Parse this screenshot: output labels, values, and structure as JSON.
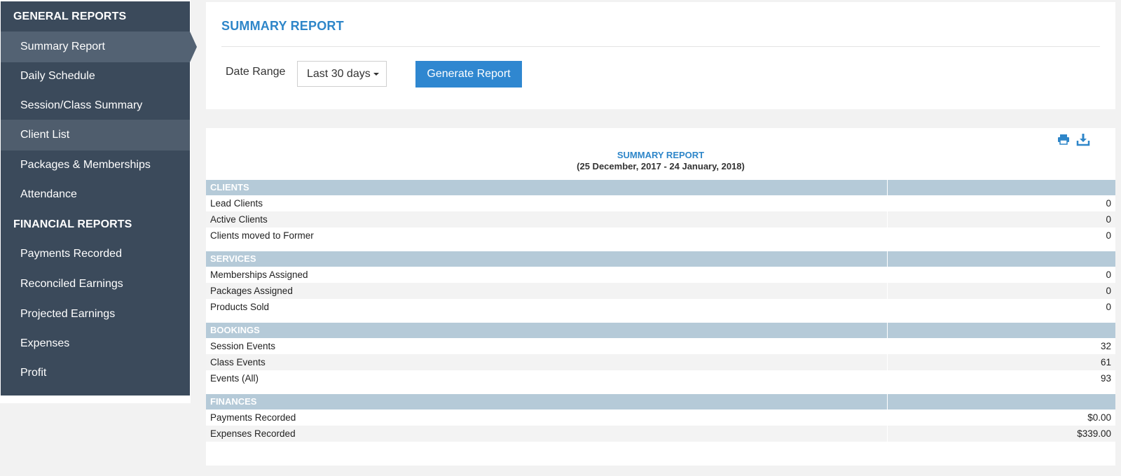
{
  "sidebar": {
    "general_heading": "GENERAL REPORTS",
    "general_items": [
      {
        "label": "Summary Report",
        "state": "active"
      },
      {
        "label": "Daily Schedule",
        "state": ""
      },
      {
        "label": "Session/Class Summary",
        "state": ""
      },
      {
        "label": "Client List",
        "state": "hover"
      },
      {
        "label": "Packages & Memberships",
        "state": ""
      },
      {
        "label": "Attendance",
        "state": ""
      }
    ],
    "financial_heading": "FINANCIAL REPORTS",
    "financial_items": [
      {
        "label": "Payments Recorded"
      },
      {
        "label": "Reconciled Earnings"
      },
      {
        "label": "Projected Earnings"
      },
      {
        "label": "Expenses"
      },
      {
        "label": "Profit"
      }
    ]
  },
  "header": {
    "title": "SUMMARY REPORT",
    "date_range_label": "Date Range",
    "date_range_value": "Last 30 days",
    "generate_button": "Generate Report"
  },
  "report": {
    "title": "SUMMARY REPORT",
    "subtitle": "(25 December, 2017 - 24 January, 2018)",
    "icons": [
      "print-icon",
      "download-icon"
    ],
    "sections": [
      {
        "name": "CLIENTS",
        "rows": [
          {
            "label": "Lead Clients",
            "value": "0"
          },
          {
            "label": "Active Clients",
            "value": "0"
          },
          {
            "label": "Clients moved to Former",
            "value": "0"
          }
        ]
      },
      {
        "name": "SERVICES",
        "rows": [
          {
            "label": "Memberships Assigned",
            "value": "0"
          },
          {
            "label": "Packages Assigned",
            "value": "0"
          },
          {
            "label": "Products Sold",
            "value": "0"
          }
        ]
      },
      {
        "name": "BOOKINGS",
        "rows": [
          {
            "label": "Session Events",
            "value": "32"
          },
          {
            "label": "Class Events",
            "value": "61"
          },
          {
            "label": "Events (All)",
            "value": "93"
          }
        ]
      },
      {
        "name": "FINANCES",
        "rows": [
          {
            "label": "Payments Recorded",
            "value": "$0.00"
          },
          {
            "label": "Expenses Recorded",
            "value": "$339.00"
          }
        ]
      }
    ]
  },
  "colors": {
    "sidebar_bg": "#3b4a5b",
    "sidebar_active": "#536273",
    "accent": "#2e86c9",
    "button": "#2f87d0",
    "section_header": "#b5cad8"
  }
}
